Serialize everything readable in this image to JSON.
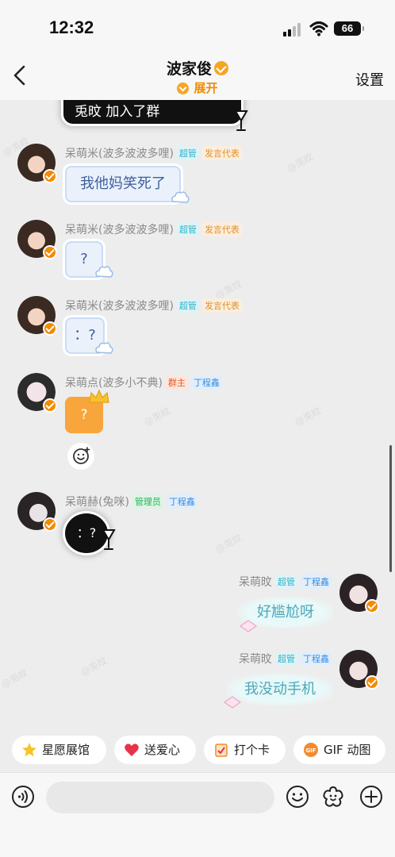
{
  "status_bar": {
    "time": "12:32",
    "battery": "66"
  },
  "header": {
    "title": "波家俊",
    "expand_label": "展开",
    "settings_label": "设置"
  },
  "system_message": {
    "text": "兎旼 加入了群"
  },
  "watermark_text": "@兎旼",
  "messages": [
    {
      "sender": "呆萌米(波多波波多哩)",
      "tags": [
        "超管",
        "发言代表"
      ],
      "text": "我他妈笑死了"
    },
    {
      "sender": "呆萌米(波多波波多哩)",
      "tags": [
        "超管",
        "发言代表"
      ],
      "text": "?"
    },
    {
      "sender": "呆萌米(波多波波多哩)",
      "tags": [
        "超管",
        "发言代表"
      ],
      "text": "：?"
    },
    {
      "sender": "呆萌点(波多小不典)",
      "tags": [
        "群主",
        "丁程鑫"
      ],
      "text": "?"
    },
    {
      "sender": "呆萌赫(兔咪)",
      "tags": [
        "管理员",
        "丁程鑫"
      ],
      "text": "：?"
    },
    {
      "sender": "呆萌旼",
      "tags": [
        "超管",
        "丁程鑫"
      ],
      "text": "好尴尬呀"
    },
    {
      "sender": "呆萌旼",
      "tags": [
        "超管",
        "丁程鑫"
      ],
      "text": "我没动手机"
    }
  ],
  "quick_actions": [
    {
      "label": "星愿展馆",
      "icon": "star-icon"
    },
    {
      "label": "送爱心",
      "icon": "heart-icon"
    },
    {
      "label": "打个卡",
      "icon": "checkin-icon"
    },
    {
      "label": "GIF 动图",
      "icon": "gif-icon"
    }
  ],
  "input": {
    "placeholder": ""
  },
  "colors": {
    "accent": "#f08a00",
    "chat_bg": "#ededed",
    "bubble_blue": "#eaf1fb",
    "bubble_orange": "#f8a53c"
  }
}
